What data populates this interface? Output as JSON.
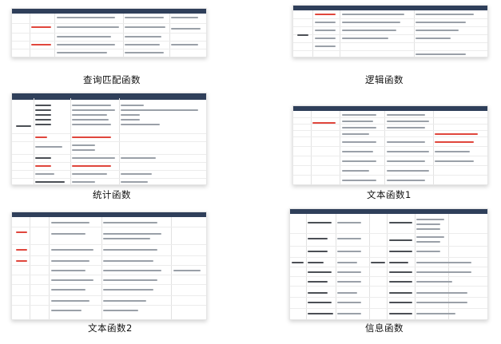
{
  "tiles": [
    {
      "title": "查询匹配函数"
    },
    {
      "title": "逻辑函数"
    },
    {
      "title": "统计函数"
    },
    {
      "title": "文本函数1"
    },
    {
      "title": "文本函数2"
    },
    {
      "title": "信息函数"
    }
  ]
}
